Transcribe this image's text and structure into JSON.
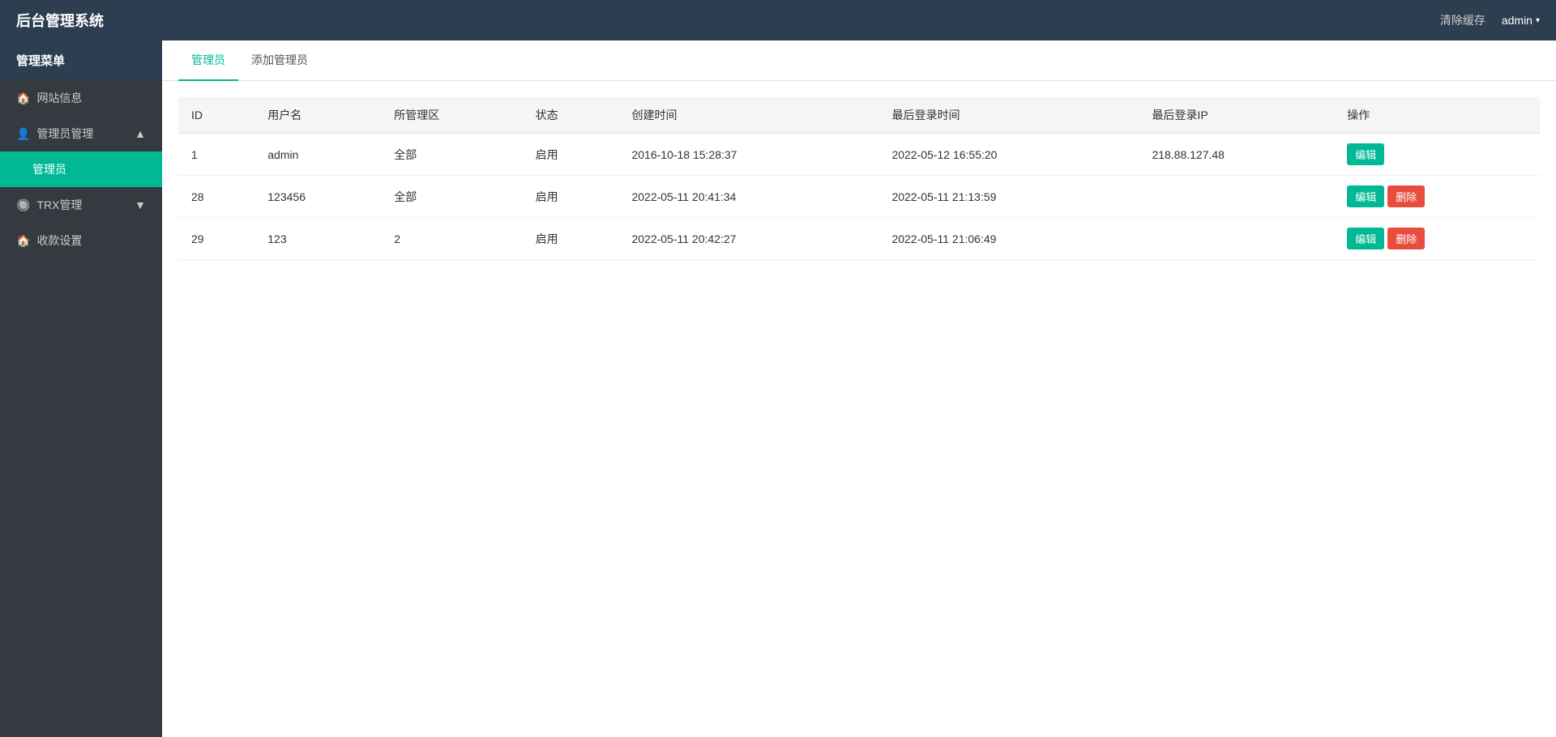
{
  "header": {
    "title": "后台管理系统",
    "clear_cache": "清除缓存",
    "user": "admin",
    "chevron": "▾"
  },
  "sidebar": {
    "menu_label": "管理菜单",
    "items": [
      {
        "id": "website-info",
        "icon": "🏠",
        "label": "网站信息",
        "type": "item"
      },
      {
        "id": "admin-management",
        "icon": "👤",
        "label": "管理员管理",
        "type": "parent",
        "expanded": true,
        "children": [
          {
            "id": "admin-list",
            "label": "管理员",
            "active": true
          }
        ]
      },
      {
        "id": "trx-management",
        "icon": "🔘",
        "label": "TRX管理",
        "type": "parent",
        "expanded": false
      },
      {
        "id": "payment-settings",
        "icon": "🏠",
        "label": "收款设置",
        "type": "item"
      }
    ]
  },
  "tabs": [
    {
      "id": "admin-tab",
      "label": "管理员",
      "active": true
    },
    {
      "id": "add-admin-tab",
      "label": "添加管理员",
      "active": false
    }
  ],
  "table": {
    "columns": [
      "ID",
      "用户名",
      "所管理区",
      "状态",
      "创建时间",
      "最后登录时间",
      "最后登录IP",
      "操作"
    ],
    "rows": [
      {
        "id": "1",
        "username": "admin",
        "managed_area": "全部",
        "status": "启用",
        "created_at": "2016-10-18 15:28:37",
        "last_login": "2022-05-12 16:55:20",
        "last_ip": "218.88.127.48",
        "can_delete": false
      },
      {
        "id": "28",
        "username": "123456",
        "managed_area": "全部",
        "status": "启用",
        "created_at": "2022-05-11 20:41:34",
        "last_login": "2022-05-11 21:13:59",
        "last_ip": "",
        "can_delete": true
      },
      {
        "id": "29",
        "username": "123",
        "managed_area": "2",
        "status": "启用",
        "created_at": "2022-05-11 20:42:27",
        "last_login": "2022-05-11 21:06:49",
        "last_ip": "",
        "can_delete": true
      }
    ],
    "btn_edit": "编辑",
    "btn_delete": "删除"
  }
}
